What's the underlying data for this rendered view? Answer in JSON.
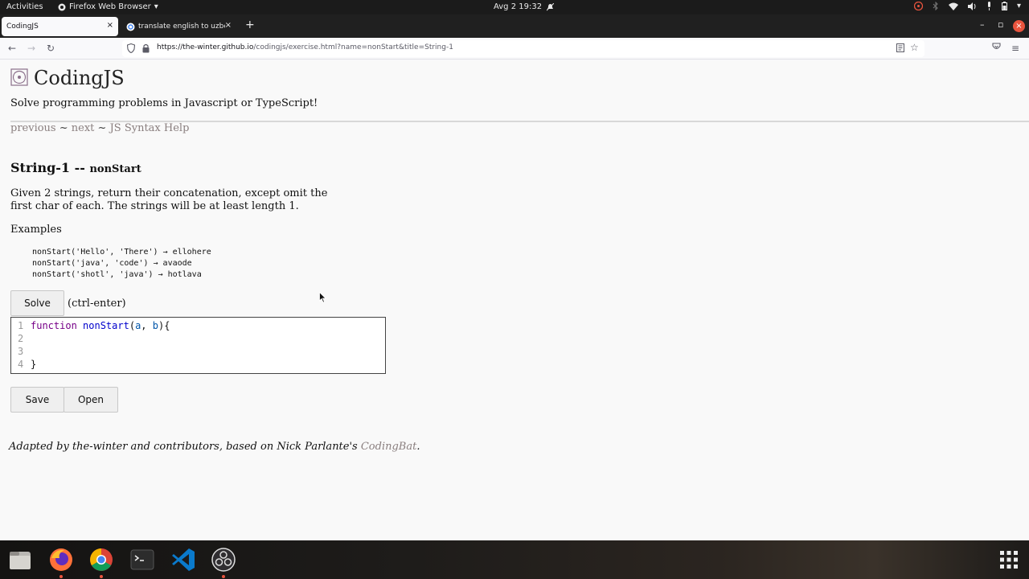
{
  "topbar": {
    "activities": "Activities",
    "app_name": "Firefox Web Browser",
    "clock": "Avg 2  19:32"
  },
  "tabs": [
    {
      "label": "CodingJS",
      "close": "×"
    },
    {
      "label": "translate english to uzbek",
      "close": "×"
    }
  ],
  "new_tab": "+",
  "urlbar": {
    "url_host": "https://the-winter.github.io",
    "url_path": "/codingjs/exercise.html?name=nonStart&title=String-1"
  },
  "site": {
    "title": "CodingJS",
    "tagline": "Solve programming problems in Javascript or TypeScript!",
    "nav_previous": "previous",
    "nav_sep1": " ~ ",
    "nav_next": "next",
    "nav_sep2": " ~ ",
    "nav_help": "JS Syntax Help"
  },
  "exercise": {
    "title": "String-1 -- ",
    "name": "nonStart",
    "description": "Given 2 strings, return their concatenation, except omit the first char of each. The strings will be at least length 1.",
    "examples_heading": "Examples",
    "examples": [
      "nonStart('Hello', 'There') → ellohere",
      "nonStart('java', 'code') → avaode",
      "nonStart('shotl', 'java') → hotlava"
    ]
  },
  "controls": {
    "solve": "Solve",
    "solve_hint": "(ctrl-enter)",
    "save": "Save",
    "open": "Open"
  },
  "editor": {
    "line_numbers": [
      "1",
      "2",
      "3",
      "4"
    ],
    "kw_function": "function",
    "fn_name": "nonStart",
    "params_open": "(",
    "param_a": "a",
    "comma": ", ",
    "param_b": "b",
    "params_close": "){",
    "closing_brace": "}"
  },
  "footer": {
    "text": "Adapted by the-winter and contributors, based on Nick Parlante's ",
    "link": "CodingBat",
    "end": "."
  },
  "colors": {
    "accent_close": "#e9543e",
    "link": "#8a7f7f"
  }
}
